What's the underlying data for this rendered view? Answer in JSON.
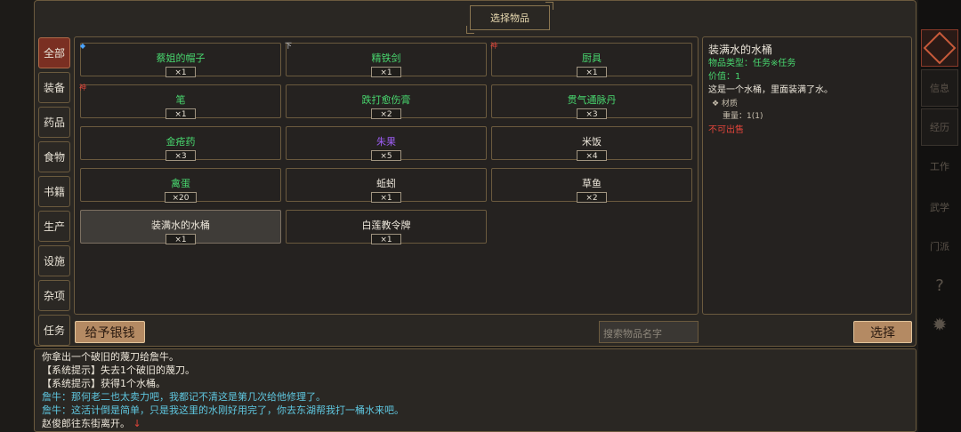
{
  "window": {
    "title": "选择物品"
  },
  "tabs": [
    "全部",
    "装备",
    "药品",
    "食物",
    "书籍",
    "生产",
    "设施",
    "杂项",
    "任务"
  ],
  "items": [
    {
      "name": "蔡姐的帽子",
      "qty": "×1",
      "color": "green",
      "badge": "◆",
      "badge_color": "blue"
    },
    {
      "name": "精铁剑",
      "qty": "×1",
      "color": "green",
      "badge": "下",
      "badge_color": "gray"
    },
    {
      "name": "厨具",
      "qty": "×1",
      "color": "green",
      "badge": "神",
      "badge_color": "red"
    },
    {
      "name": "笔",
      "qty": "×1",
      "color": "green",
      "badge": "神",
      "badge_color": "red"
    },
    {
      "name": "跌打愈伤膏",
      "qty": "×2",
      "color": "green",
      "badge": "",
      "badge_color": ""
    },
    {
      "name": "贯气通脉丹",
      "qty": "×3",
      "color": "green",
      "badge": "",
      "badge_color": ""
    },
    {
      "name": "金疮药",
      "qty": "×3",
      "color": "green",
      "badge": "",
      "badge_color": ""
    },
    {
      "name": "朱果",
      "qty": "×5",
      "color": "purple",
      "badge": "",
      "badge_color": ""
    },
    {
      "name": "米饭",
      "qty": "×4",
      "color": "white",
      "badge": "",
      "badge_color": ""
    },
    {
      "name": "禽蛋",
      "qty": "×20",
      "color": "green",
      "badge": "",
      "badge_color": ""
    },
    {
      "name": "蚯蚓",
      "qty": "×1",
      "color": "white",
      "badge": "",
      "badge_color": ""
    },
    {
      "name": "草鱼",
      "qty": "×2",
      "color": "white",
      "badge": "",
      "badge_color": ""
    },
    {
      "name": "装满水的水桶",
      "qty": "×1",
      "color": "white",
      "badge": "",
      "badge_color": "",
      "selected": true
    },
    {
      "name": "白莲教令牌",
      "qty": "×1",
      "color": "white",
      "badge": "",
      "badge_color": ""
    }
  ],
  "detail": {
    "title": "装满水的水桶",
    "type": "物品类型：任务※任务",
    "value": "价值：1",
    "desc": "这是一个水桶，里面装满了水。",
    "material": "❖ 材质",
    "weight": "重量：1(1)",
    "unsellable": "不可出售"
  },
  "buttons": {
    "give_money": "给予银钱",
    "select": "选择"
  },
  "search": {
    "placeholder": "搜索物品名字"
  },
  "log": [
    {
      "text": "你拿出一个破旧的蔑刀给詹牛。",
      "kind": "sys"
    },
    {
      "text": "【系统提示】失去1个破旧的蔑刀。",
      "kind": "sys"
    },
    {
      "text": "【系统提示】获得1个水桶。",
      "kind": "sys"
    },
    {
      "text": "詹牛：那何老二也太卖力吧，我都记不清这是第几次给他修理了。",
      "kind": "npc"
    },
    {
      "text": "詹牛：这活计倒是简单，只是我这里的水刚好用完了，你去东湖帮我打一桶水来吧。",
      "kind": "npc"
    },
    {
      "text": "赵俊郎往东街离开。",
      "kind": "sys"
    }
  ],
  "side": {
    "info": "信息",
    "history": "经历",
    "work": "工作",
    "study": "武学",
    "faction": "门派",
    "help": "?"
  }
}
